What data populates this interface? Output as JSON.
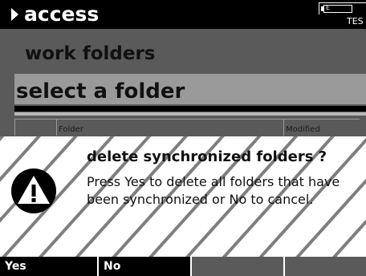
{
  "header": {
    "title": "access",
    "status_text": "TES",
    "battery_label": "E"
  },
  "screen": {
    "subtitle": "work folders",
    "selector_label": "select a folder",
    "columns": [
      "Folder",
      "Modified"
    ]
  },
  "dialog": {
    "title": "delete synchronized folders ?",
    "message": "Press Yes to delete all folders that have been synchronized or No to cancel."
  },
  "softkeys": {
    "yes": "Yes",
    "no": "No",
    "key3": "",
    "key4": ""
  }
}
